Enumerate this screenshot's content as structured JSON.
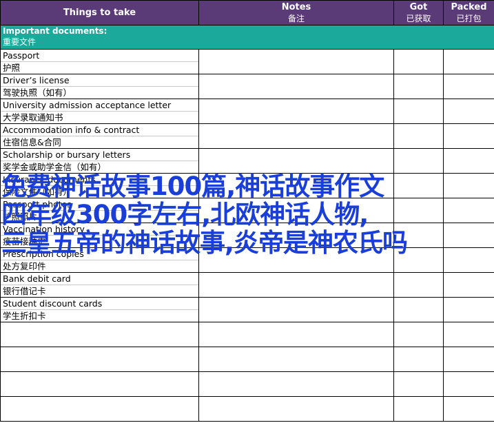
{
  "header": {
    "col1": "Things to take",
    "col2_en": "Notes",
    "col2_zh": "备注",
    "col3_en": "Got",
    "col3_zh": "已获取",
    "col4_en": "Packed",
    "col4_zh": "已打包"
  },
  "section": {
    "title_en": "Important documents:",
    "title_zh": "重要文件"
  },
  "items": [
    {
      "en": "Passport",
      "zh": "护照"
    },
    {
      "en": "Driver’s license",
      "zh": "驾驶执照（如有）"
    },
    {
      "en": "University admission acceptance letter",
      "zh": "大学录取通知书"
    },
    {
      "en": "Accommodation info & contract",
      "zh": "住宿信息&合同"
    },
    {
      "en": "Scholarship or bursary letters",
      "zh": "奖学金或助学金信（如有）"
    },
    {
      "en": "Insurance documents",
      "zh": "保险文件（如有）"
    },
    {
      "en": "Passport photos",
      "zh": "护照照片"
    },
    {
      "en": "Vaccination history",
      "zh": "疫苗接种史"
    },
    {
      "en": "Prescription copies",
      "zh": "处方复印件"
    },
    {
      "en": "Bank debit card",
      "zh": "银行借记卡"
    },
    {
      "en": "Student discount cards",
      "zh": "学生折扣卡"
    }
  ],
  "overlay": {
    "line1": "免费神话故事100篇,神话故事作文",
    "line2": "四年级300字左右,北欧神话人物,",
    "line3": "三皇五帝的神话故事,炎帝是神农氏吗"
  },
  "colors": {
    "header_bg": "#5b3a78",
    "section_bg": "#1aa99a",
    "overlay_text": "#1a3ed8"
  }
}
